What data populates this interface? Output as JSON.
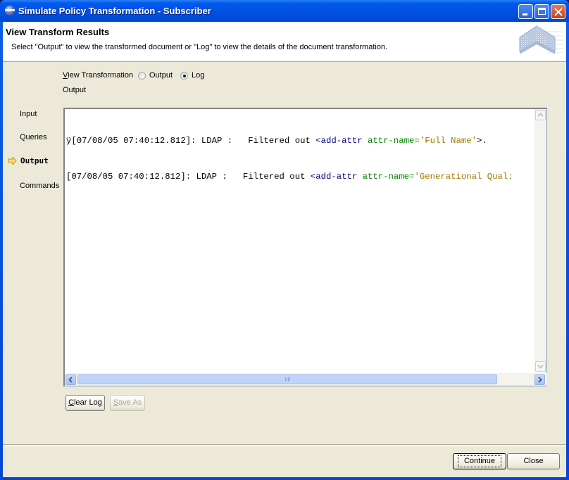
{
  "window": {
    "title": "Simulate Policy Transformation - Subscriber",
    "controls": [
      "minimize",
      "maximize",
      "close"
    ]
  },
  "header": {
    "title": "View Transform Results",
    "description": "Select \"Output\" to view the transformed document or \"Log\" to view the details of the document transformation."
  },
  "view_transformation": {
    "label_prefix": "V",
    "label_rest": "iew Transformation",
    "options": [
      {
        "label": "Output",
        "selected": false
      },
      {
        "label": "Log",
        "selected": true
      }
    ]
  },
  "output_label": "Output",
  "nav": {
    "items": [
      {
        "label": "Input",
        "active": false
      },
      {
        "label": "Queries",
        "active": false
      },
      {
        "label": "Output",
        "active": true
      },
      {
        "label": "Commands",
        "active": false
      }
    ]
  },
  "log": {
    "lines": [
      {
        "prefix": "ÿ[07/08/05 07:40:12.812]: LDAP :   Filtered out ",
        "tag": "<add-attr",
        "attr": " attr-name=",
        "value": "'Full Name'",
        "suffix": ">."
      },
      {
        "prefix": "[07/08/05 07:40:12.812]: LDAP :   Filtered out ",
        "tag": "<add-attr",
        "attr": " attr-name=",
        "value": "'Generational Qual:",
        "suffix": ""
      }
    ]
  },
  "buttons": {
    "clear_log_accel": "C",
    "clear_log_rest": "lear Log",
    "save_as_accel": "S",
    "save_as_rest": "ave As",
    "continue": "Continue",
    "close": "Close"
  }
}
